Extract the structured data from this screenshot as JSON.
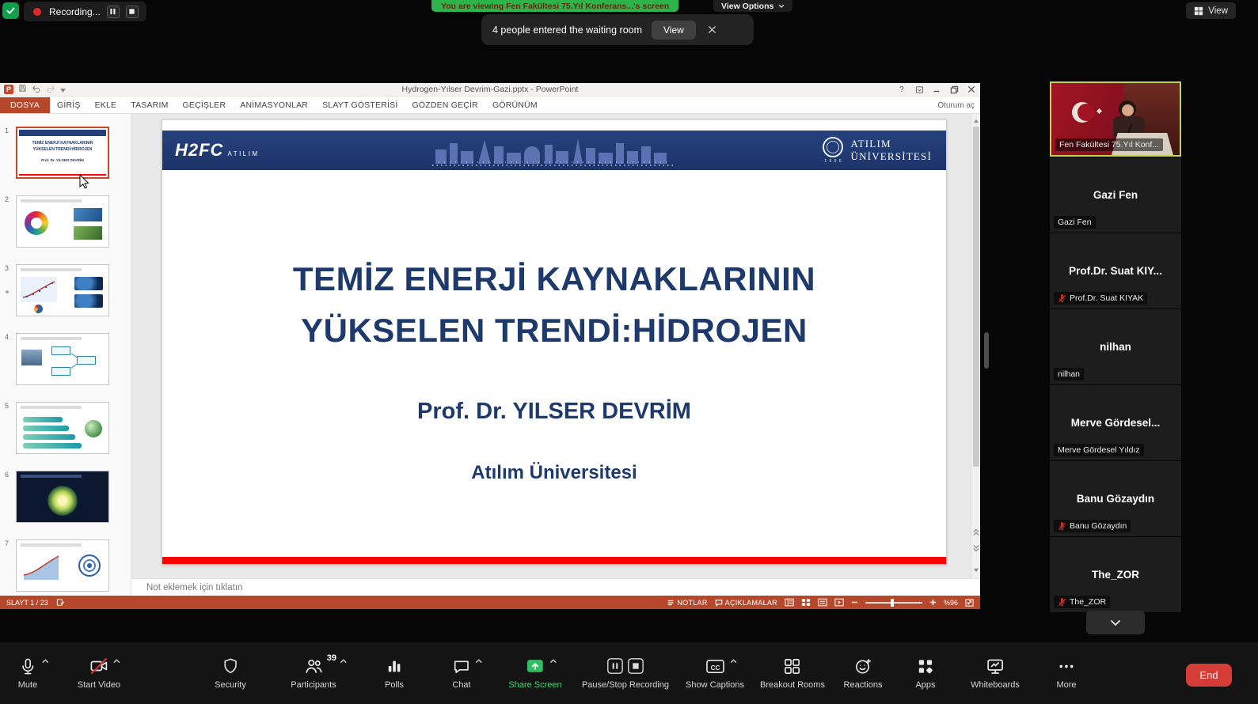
{
  "meeting": {
    "recording_label": "Recording...",
    "share_banner": "You are viewing Fen Fakültesi 75.Yıl Konferans...'s screen",
    "view_options_label": "View Options",
    "top_view_label": "View",
    "toast_message": "4 people entered the waiting room",
    "toast_view_label": "View"
  },
  "powerpoint": {
    "window_title": "Hydrogen-Yılser Devrim-Gazi.pptx - PowerPoint",
    "sign_in_label": "Oturum aç",
    "tabs": [
      "DOSYA",
      "GİRİŞ",
      "EKLE",
      "TASARIM",
      "GEÇİŞLER",
      "ANİMASYONLAR",
      "SLAYT GÖSTERİSİ",
      "GÖZDEN GEÇİR",
      "GÖRÜNÜM"
    ],
    "slide_numbers": [
      "1",
      "2",
      "3",
      "4",
      "5",
      "6",
      "7"
    ],
    "slide": {
      "logo_left_main": "H2FC",
      "logo_left_sub": "ATILIM",
      "logo_right_line1": "ATILIM",
      "logo_right_line2": "ÜNİVERSİTESİ",
      "logo_right_year": "1 9 9 6",
      "title_line1": "TEMİZ ENERJİ KAYNAKLARININ",
      "title_line2": "YÜKSELEN TRENDİ:HİDROJEN",
      "presenter": "Prof. Dr. YILSER DEVRİM",
      "affiliation": "Atılım Üniversitesi"
    },
    "notes_placeholder": "Not eklemek için tıklatın",
    "status": {
      "slide_indicator": "SLAYT 1 / 23",
      "notes_label": "NOTLAR",
      "comments_label": "AÇIKLAMALAR",
      "zoom_level": "%96"
    }
  },
  "participants": {
    "tiles": [
      {
        "label": "Fen Fakültesi 75.Yıl Konf..."
      },
      {
        "name": "Gazi Fen",
        "label": "Gazi Fen",
        "muted": false
      },
      {
        "name": "Prof.Dr. Suat KIY...",
        "label": "Prof.Dr. Suat KIYAK",
        "muted": true
      },
      {
        "name": "nilhan",
        "label": "nilhan",
        "muted": false
      },
      {
        "name": "Merve  Gördesel...",
        "label": "Merve Gördesel Yıldız",
        "muted": false
      },
      {
        "name": "Banu Gözaydın",
        "label": "Banu Gözaydın",
        "muted": true
      },
      {
        "name": "The_ZOR",
        "label": "The_ZOR",
        "muted": true
      }
    ]
  },
  "toolbar": {
    "mute": "Mute",
    "start_video": "Start Video",
    "security": "Security",
    "participants": "Participants",
    "participants_count": "39",
    "polls": "Polls",
    "chat": "Chat",
    "share_screen": "Share Screen",
    "pause_stop_recording": "Pause/Stop Recording",
    "show_captions": "Show Captions",
    "breakout_rooms": "Breakout Rooms",
    "reactions": "Reactions",
    "apps": "Apps",
    "whiteboards": "Whiteboards",
    "more": "More",
    "end": "End"
  },
  "glyphs": {
    "cc": "CC",
    "ppt_app_letter": "P",
    "help": "?"
  },
  "colors": {
    "zoom_green": "#2cb34a",
    "share_accent": "#2fbe63",
    "ppt_accent": "#b7472a",
    "slide_navy": "#1e3a6d",
    "record_red": "#e02828",
    "end_red": "#d63c36",
    "active_speaker_border": "#c3d34f"
  }
}
